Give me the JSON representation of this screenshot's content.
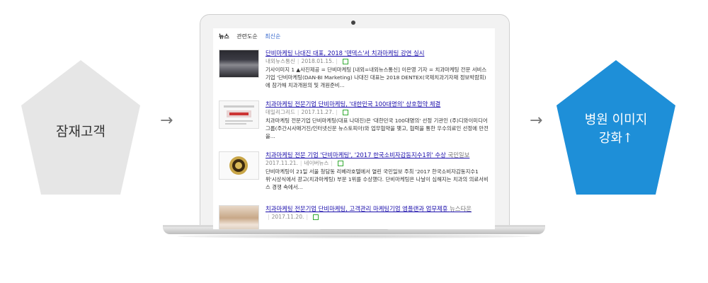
{
  "left_pentagon": {
    "label": "잠재고객",
    "color": "#e6e6e6"
  },
  "right_pentagon": {
    "line1": "병원 이미지",
    "line2": "강화↑",
    "color": "#1e8fd8"
  },
  "arrows": {
    "left": "→",
    "right": "→"
  },
  "news": {
    "tabs": [
      "뉴스",
      "관련도순",
      "최신순"
    ],
    "items": [
      {
        "title": "단비마케팅 나대진 대표, 2018 '덴덱스'서 치과마케팅 강연 실시",
        "source": "내외뉴스통신",
        "date": "2018.01.15.",
        "desc": "기사이미지 1 ▲사진제공 = 단비마케팅 [내외=내외뉴스통신] 이은영 기자 = 치과마케팅 전문 서비스기업 '단비마케팅(DAN-BI Marketing) 나대진 대표는 2018 DENTEX(국제치과기자재 정보박람회)에 참가해 치과개원의 및 개원준비..."
      },
      {
        "title": "치과마케팅 전문기업 단비마케팅, '대한민국 100대명의' 상호협약 체결",
        "source": "데일리그리드",
        "date": "2017.11.27.",
        "desc": "치과마케팅 전문기업 단비마케팅(대표 나대진)은 '대한민국 100대명의' 선정 기관인 (주)디와이미디어그룹(주간시사매거진/인터넷신문 뉴스토피아)와 업무협약을 맺고, 협력을 통한 우수의료인 선정에 만전을..."
      },
      {
        "title": "치과마케팅 전문 기업 '단비마케팅', '2017 한국소비자감동지수1위' 수상",
        "suffix": "국민일보",
        "date": "2017.11.21.",
        "source": "네이버뉴스",
        "desc": "단비마케팅이 21일 서울 청담동 리베라호텔에서 열린 국민일보 주최 '2017 한국소비자감동지수1위'시상식에서 광고(치과마케팅) 부문 1위를 수상했다. 단비마케팅은 나날이 심해지는 치과의 의료서비스 경쟁 속에서..."
      },
      {
        "title": "치과마케팅 전문기업 단비마케팅, 고객관리 마케팅기업 엠플랜과 업무제휴",
        "suffix": "뉴스타운",
        "date": "2017.11.20."
      }
    ]
  }
}
